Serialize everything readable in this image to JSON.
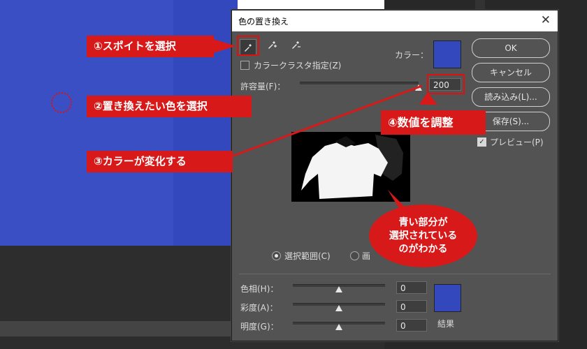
{
  "dialog": {
    "title": "色の置き換え",
    "close_label": "✕",
    "color_label": "カラー：",
    "localized_cluster_label": "カラークラスタ指定(Z)",
    "tolerance_label": "許容量(F)：",
    "tolerance_value": "200",
    "tolerance_level": 1.0,
    "selection_label": "選択範囲(C)",
    "image_label": "画",
    "hue_label": "色相(H)：",
    "hue_value": "0",
    "saturation_label": "彩度(A)：",
    "saturation_value": "0",
    "lightness_label": "明度(G)：",
    "lightness_value": "0",
    "result_label": "結果",
    "buttons": {
      "ok": "OK",
      "cancel": "キャンセル",
      "load": "読み込み(L)...",
      "save": "保存(S)...",
      "preview": "プレビュー(P)"
    },
    "colors": {
      "target": "#3448bd",
      "result": "#3448bd"
    }
  },
  "annotations": {
    "step1": "①スポイトを選択",
    "step2": "②置き換えたい色を選択",
    "step3": "③カラーが変化する",
    "step4": "④数値を調整",
    "bubble_line1": "青い部分が",
    "bubble_line2": "選択されている",
    "bubble_line3": "のがわかる",
    "accent": "#d81919"
  }
}
